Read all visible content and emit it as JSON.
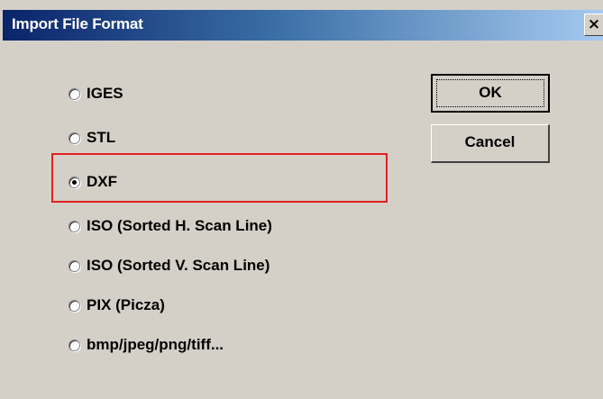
{
  "window": {
    "title": "Import File Format",
    "close_icon": "close-icon",
    "close_glyph": "×"
  },
  "options": [
    {
      "label": "IGES",
      "selected": false
    },
    {
      "label": "STL",
      "selected": false
    },
    {
      "label": "DXF",
      "selected": true
    },
    {
      "label": "ISO (Sorted H. Scan Line)",
      "selected": false
    },
    {
      "label": "ISO (Sorted V. Scan Line)",
      "selected": false
    },
    {
      "label": "PIX (Picza)",
      "selected": false
    },
    {
      "label": "bmp/jpeg/png/tiff...",
      "selected": false
    }
  ],
  "buttons": {
    "ok_label": "OK",
    "cancel_label": "Cancel"
  },
  "colors": {
    "title_bar_start": "#0a246a",
    "title_bar_end": "#a6caf0",
    "dialog_background": "#d4d0c8",
    "highlight": "#e02020"
  }
}
